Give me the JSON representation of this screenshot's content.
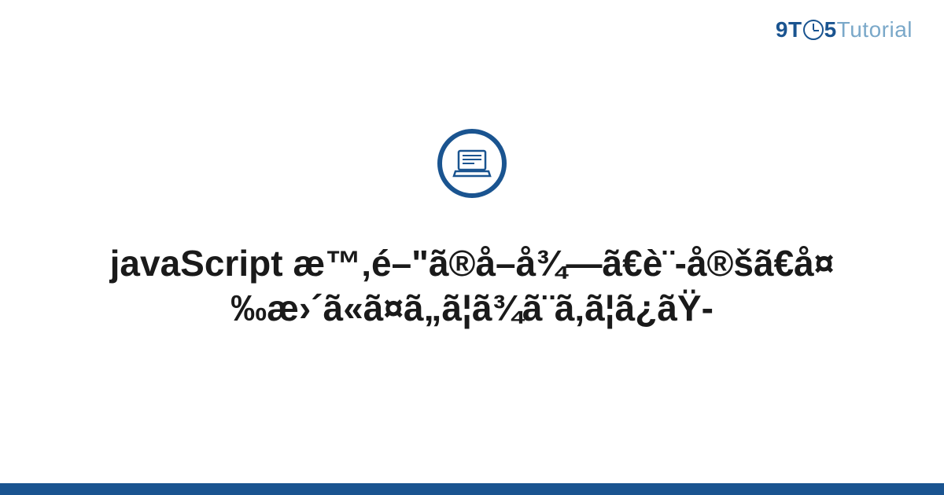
{
  "logo": {
    "part1": "9T",
    "part2": "5",
    "part3": "Tutorial"
  },
  "icon": {
    "name": "laptop-icon"
  },
  "title": "javaScript æ™‚é–\"ã®å–å¾—ã€è¨-å®šã€å¤‰æ›´ã«ã¤ã„ã¦ã¾ã¨ã‚ã¦ã¿ãŸ-",
  "colors": {
    "primary": "#1a5490",
    "secondary": "#7aa8c9"
  }
}
